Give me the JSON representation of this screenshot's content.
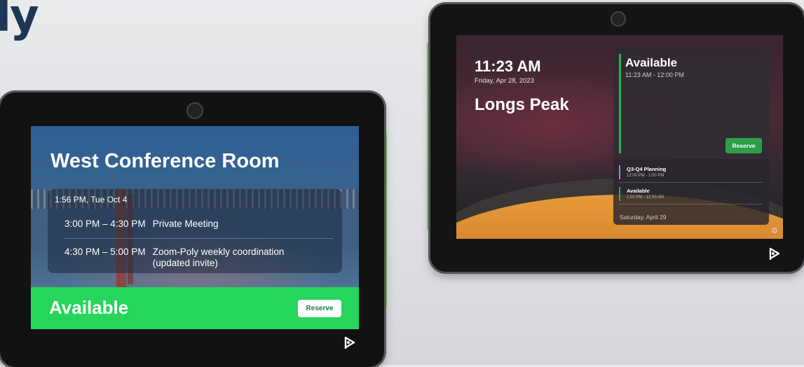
{
  "brand_partial": "ly",
  "left_device": {
    "room_title": "West Conference Room",
    "current_time": "1:56 PM, Tue Oct 4",
    "events": [
      {
        "time": "3:00 PM – 4:30 PM",
        "title": "Private Meeting"
      },
      {
        "time": "4:30 PM – 5:00 PM",
        "title": "Zoom-Poly weekly coordination (updated invite)"
      }
    ],
    "status": "Available",
    "reserve_label": "Reserve",
    "status_color": "#26d65a"
  },
  "right_device": {
    "clock": "11:23 AM",
    "date": "Friday, Apr 28, 2023",
    "room_name": "Longs Peak",
    "status": "Available",
    "status_time": "11:23 AM - 12:00 PM",
    "reserve_label": "Reserve",
    "events": [
      {
        "title": "Q3-Q4 Planning",
        "time": "12:00 PM - 1:00 PM",
        "color": "#8f8fd8"
      },
      {
        "title": "Available",
        "time": "1:00 PM - 12:00 AM",
        "color": "#2eb24d"
      }
    ],
    "footer_date": "Saturday, April 29",
    "settings_icon": "gear-icon"
  },
  "led_color": "#7ed957",
  "logo_icon": "poly-logo-icon"
}
